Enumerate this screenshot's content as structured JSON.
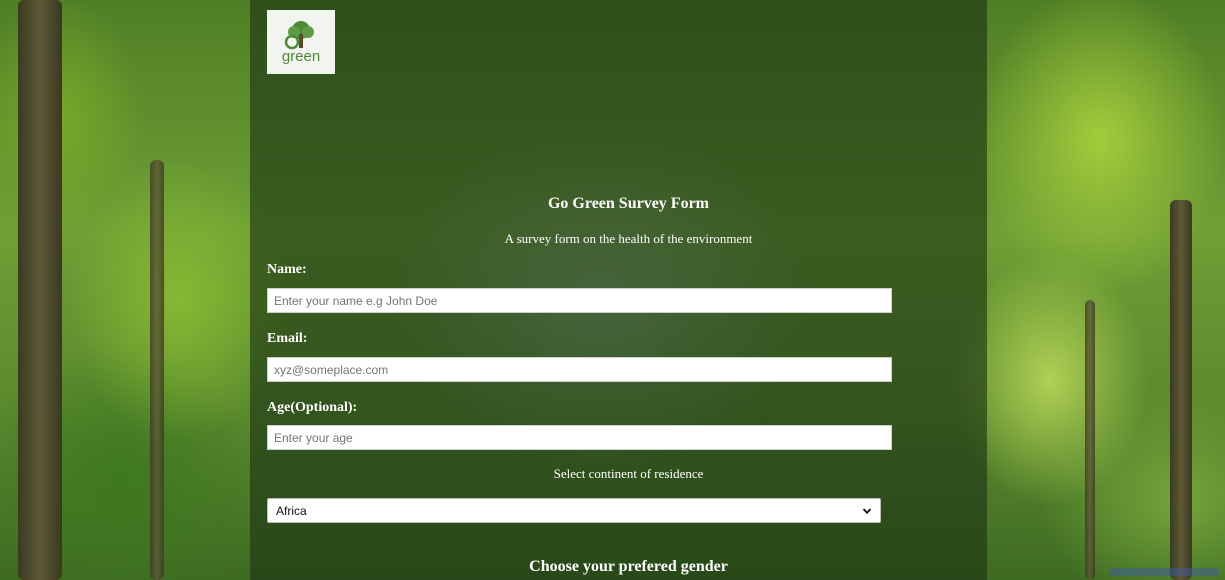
{
  "logo": {
    "text": "green",
    "icon": "tree-logo-icon"
  },
  "form": {
    "title": "Go Green Survey Form",
    "subtitle": "A survey form on the health of the environment",
    "name_label": "Name:",
    "name_placeholder": "Enter your name e.g John Doe",
    "email_label": "Email:",
    "email_placeholder": "xyz@someplace.com",
    "age_label": "Age(Optional):",
    "age_placeholder": "Enter your age",
    "continent_label": "Select continent of residence",
    "continent_selected": "Africa",
    "gender_title": "Choose your prefered gender"
  },
  "colors": {
    "panel": "#1c3414",
    "text": "#ffffff",
    "logo_green": "#4c8a35"
  }
}
